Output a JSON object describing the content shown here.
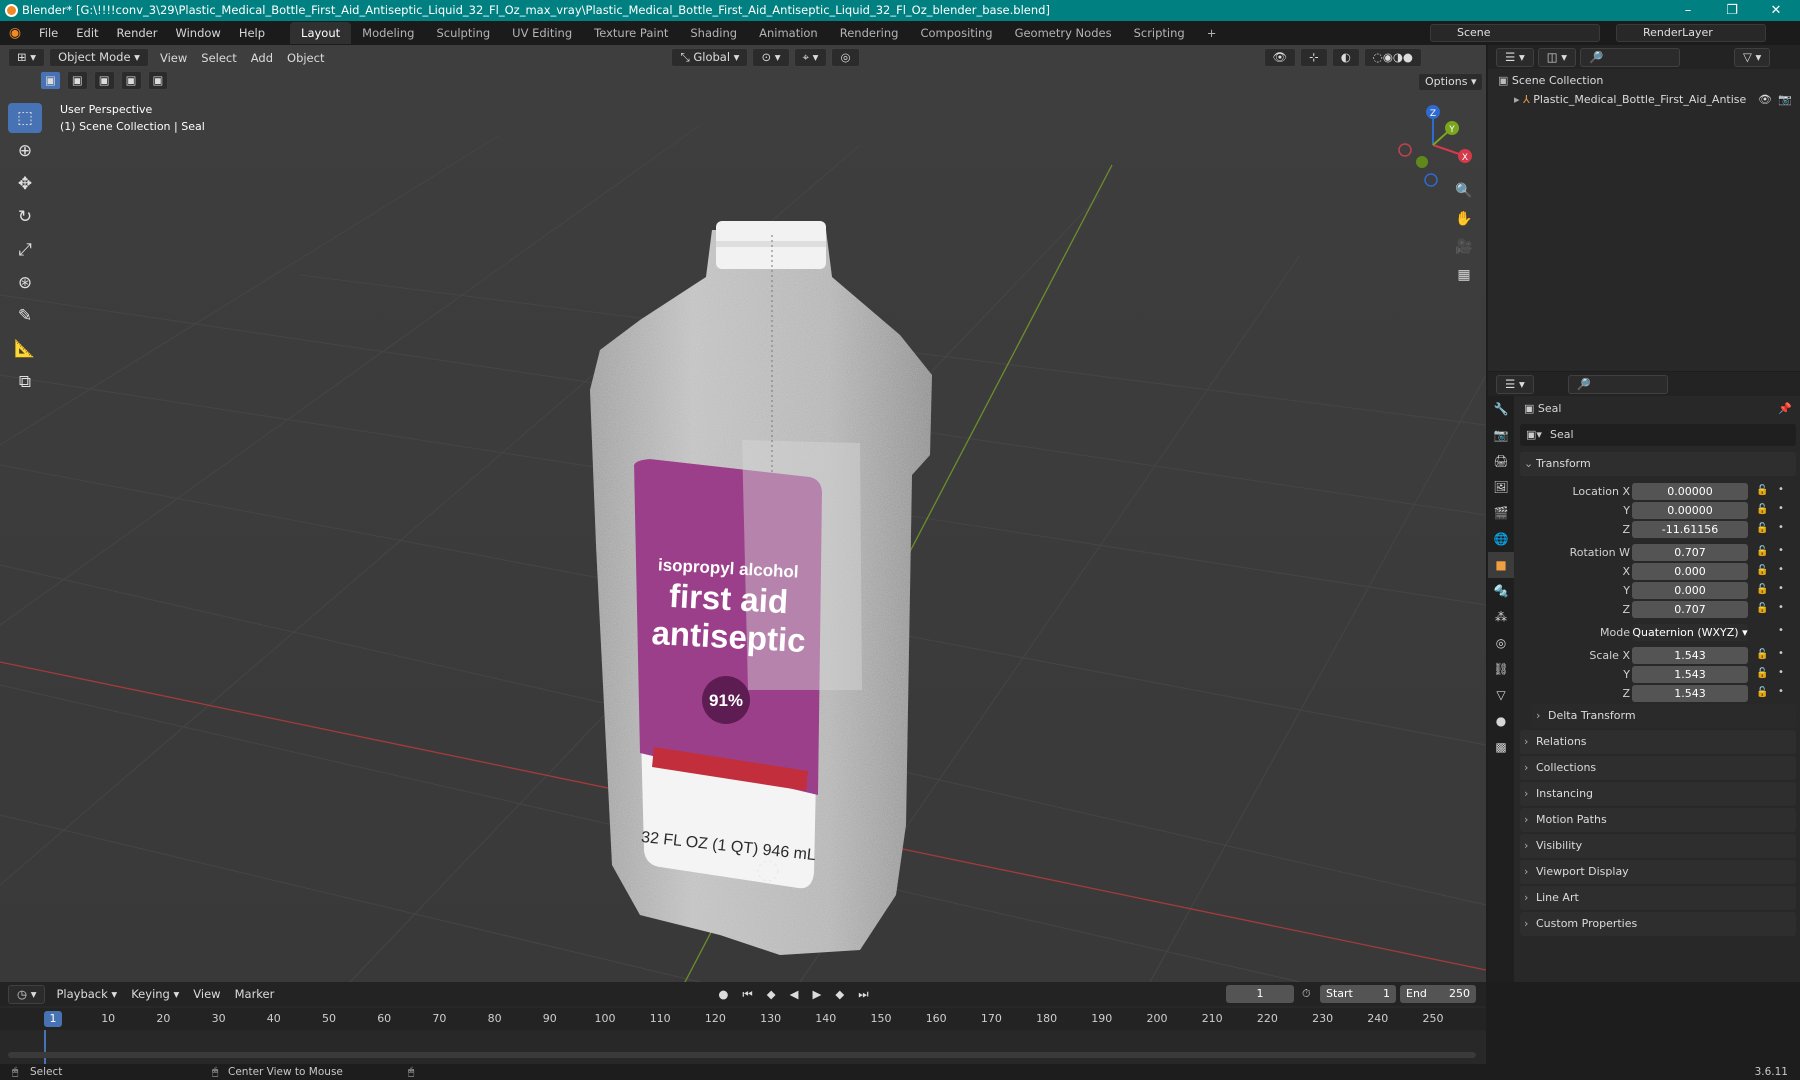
{
  "window": {
    "title": "Blender* [G:\\!!!!conv_3\\29\\Plastic_Medical_Bottle_First_Aid_Antiseptic_Liquid_32_Fl_Oz_max_vray\\Plastic_Medical_Bottle_First_Aid_Antiseptic_Liquid_32_Fl_Oz_blender_base.blend]",
    "min": "–",
    "max": "❐",
    "close": "✕"
  },
  "menu": [
    "File",
    "Edit",
    "Render",
    "Window",
    "Help"
  ],
  "workspaces": [
    "Layout",
    "Modeling",
    "Sculpting",
    "UV Editing",
    "Texture Paint",
    "Shading",
    "Animation",
    "Rendering",
    "Compositing",
    "Geometry Nodes",
    "Scripting"
  ],
  "scene": "Scene",
  "render_layer": "RenderLayer",
  "viewport": {
    "mode": "Object Mode",
    "menus": [
      "View",
      "Select",
      "Add",
      "Object"
    ],
    "transform_orientation": "Global",
    "options": "Options",
    "perspective": "User Perspective",
    "context": "(1) Scene Collection | Seal"
  },
  "bottle_label": {
    "line1": "isopropyl alcohol",
    "line2": "first aid",
    "line3": "antiseptic",
    "percent": "91%",
    "volume": "32 FL OZ (1 QT) 946 mL"
  },
  "outliner": {
    "collection": "Scene Collection",
    "object": "Plastic_Medical_Bottle_First_Aid_Antise"
  },
  "properties": {
    "object_name": "Seal",
    "data_name": "Seal",
    "transform_title": "Transform",
    "location": {
      "label_x": "Location X",
      "label_y": "Y",
      "label_z": "Z",
      "x": "0.00000",
      "y": "0.00000",
      "z": "-11.61156"
    },
    "rotation": {
      "label_w": "Rotation W",
      "label_x": "X",
      "label_y": "Y",
      "label_z": "Z",
      "w": "0.707",
      "x": "0.000",
      "y": "0.000",
      "z": "0.707"
    },
    "mode": {
      "label": "Mode",
      "value": "Quaternion (WXYZ)"
    },
    "scale": {
      "label_x": "Scale X",
      "label_y": "Y",
      "label_z": "Z",
      "x": "1.543",
      "y": "1.543",
      "z": "1.543"
    },
    "delta": "Delta Transform",
    "panels": [
      "Relations",
      "Collections",
      "Instancing",
      "Motion Paths",
      "Visibility",
      "Viewport Display",
      "Line Art",
      "Custom Properties"
    ]
  },
  "timeline": {
    "menus": [
      "Playback",
      "Keying",
      "View",
      "Marker"
    ],
    "current_frame": "1",
    "start_label": "Start",
    "start": "1",
    "end_label": "End",
    "end": "250",
    "frame_marks": [
      "10",
      "20",
      "30",
      "40",
      "50",
      "60",
      "70",
      "80",
      "90",
      "100",
      "110",
      "120",
      "130",
      "140",
      "150",
      "160",
      "170",
      "180",
      "190",
      "200",
      "210",
      "220",
      "230",
      "240",
      "250"
    ]
  },
  "status": {
    "select": "Select",
    "center": "Center View to Mouse",
    "version": "3.6.11"
  }
}
